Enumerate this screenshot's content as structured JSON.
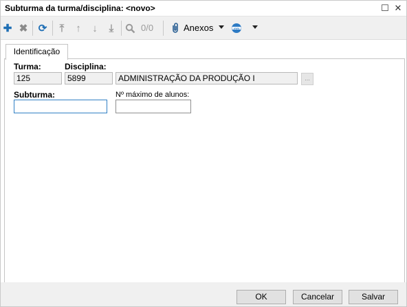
{
  "window": {
    "title": "Subturma da turma/disciplina: <novo>"
  },
  "toolbar": {
    "counter": "0/0",
    "anexos_label": "Anexos"
  },
  "tabs": [
    {
      "label": "Identificação"
    }
  ],
  "form": {
    "turma_label": "Turma:",
    "turma_value": "125",
    "disciplina_label": "Disciplina:",
    "disciplina_code": "5899",
    "disciplina_name": "ADMINISTRAÇÃO DA PRODUÇÃO I",
    "ellipsis_label": "...",
    "subturma_label": "Subturma:",
    "subturma_value": "",
    "max_alunos_label": "Nº máximo de alunos:",
    "max_alunos_value": ""
  },
  "buttons": {
    "ok": "OK",
    "cancel": "Cancelar",
    "save": "Salvar"
  },
  "colors": {
    "add_icon": "#1f6fb5",
    "refresh_icon": "#1f6fb5",
    "disabled_icon": "#9a9a9a"
  }
}
